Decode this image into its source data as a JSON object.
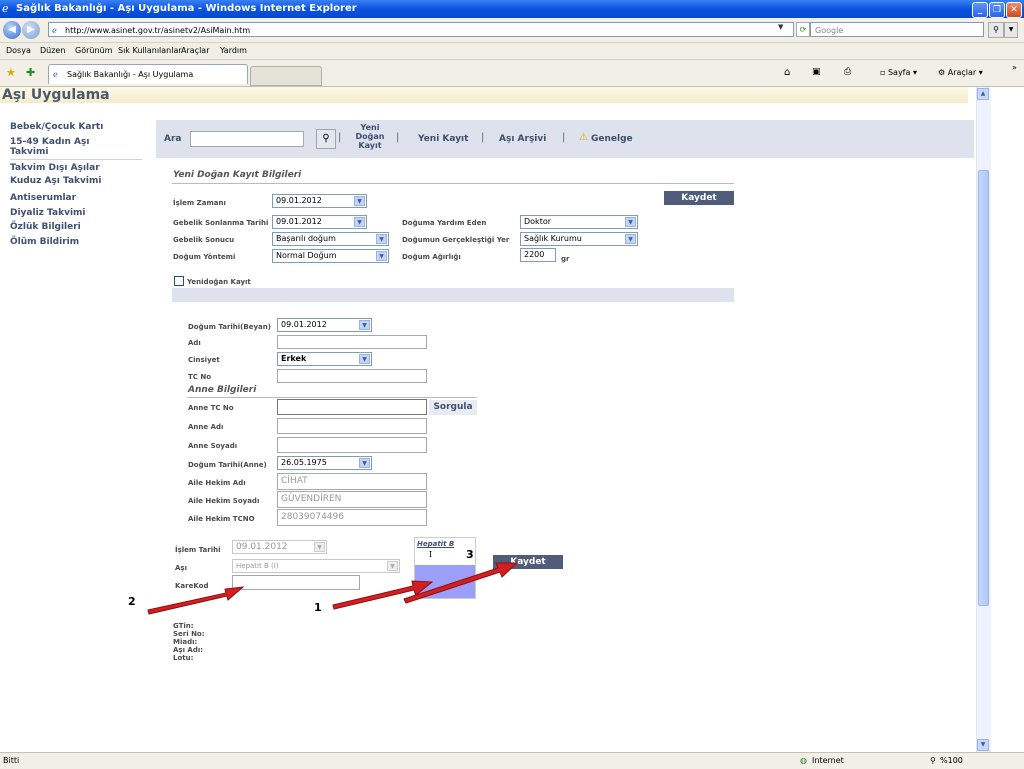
{
  "window": {
    "title": "Sağlık Bakanlığı - Aşı Uygulama - Windows Internet Explorer"
  },
  "address_bar": {
    "url": "http://www.asinet.gov.tr/asinetv2/AsiMain.htm",
    "search_placeholder": "Google"
  },
  "menu": [
    "Dosya",
    "Düzen",
    "Görünüm",
    "Sık Kullanılanlar",
    "Araçlar",
    "Yardım"
  ],
  "tab": {
    "label": "Sağlık Bakanlığı - Aşı Uygulama"
  },
  "toolbar_right": {
    "page_label": "Sayfa",
    "tools_label": "Araçlar"
  },
  "page": {
    "title": "Aşı Uygulama",
    "sidebar": [
      "Bebek/Çocuk Kartı",
      "15-49 Kadın Aşı",
      "Takvimi",
      "Takvim Dışı Aşılar",
      "Kuduz Aşı Takvimi",
      "Antiserumlar",
      "Diyaliz Takvimi",
      "Özlük Bilgileri",
      "Ölüm Bildirim"
    ],
    "searchbar": {
      "search_label": "Ara",
      "new_born_1": "Yeni",
      "new_born_2": "Doğan",
      "new_born_3": "Kayıt",
      "new_record": "Yeni Kayıt",
      "archive": "Aşı Arşivi",
      "circular": "Genelge",
      "sep": "|"
    },
    "birth_section": {
      "title": "Yeni Doğan Kayıt Bilgileri",
      "islem_zamani_label": "İşlem Zamanı",
      "islem_zamani": "09.01.2012",
      "save_button": "Kaydet",
      "gebelik_tarihi_label": "Gebelik Sonlanma Tarihi",
      "gebelik_tarihi": "09.01.2012",
      "yardim_label": "Doğuma Yardım Eden",
      "yardim": "Doktor",
      "gebelik_sonucu_label": "Gebelik Sonucu",
      "gebelik_sonucu": "Başarılı doğum",
      "yer_label": "Doğumun Gerçekleştiği Yer",
      "yer": "Sağlık Kurumu",
      "yontem_label": "Doğum Yöntemi",
      "yontem": "Normal Doğum",
      "agirlik_label": "Doğum Ağırlığı",
      "agirlik": "2200",
      "agirlik_unit": "gr",
      "newborn_checkbox": "Yenidoğan Kayıt"
    },
    "baby": {
      "dogum_tarihi_label": "Doğum Tarihi(Beyan)",
      "dogum_tarihi": "09.01.2012",
      "adi_label": "Adı",
      "cinsiyet_label": "Cinsiyet",
      "cinsiyet": "Erkek",
      "tc_label": "TC No"
    },
    "mother": {
      "title": "Anne Bilgileri",
      "tc_label": "Anne TC No",
      "query_button": "Sorgula",
      "adi_label": "Anne Adı",
      "soyadi_label": "Anne Soyadı",
      "dogum_label": "Doğum Tarihi(Anne)",
      "dogum": "26.05.1975",
      "hekim_adi_label": "Aile Hekim Adı",
      "hekim_adi": "CİHAT",
      "hekim_soyadi_label": "Aile Hekim Soyadı",
      "hekim_soyadi": "GÜVENDİREN",
      "hekim_tc_label": "Aile Hekim TCNO",
      "hekim_tc": "28039074496"
    },
    "vaccine": {
      "islem_tarihi_label": "İşlem Tarihi",
      "islem_tarihi": "09.01.2012",
      "asi_label": "Aşı",
      "asi": "Hepatit B (I)",
      "karekod_label": "KareKod",
      "card_title": "Hepatit B",
      "card_dose": "I",
      "save_button": "Kaydet",
      "info": [
        "GTin:",
        "Seri No:",
        "Miadı:",
        "Aşı Adı:",
        "Lotu:"
      ]
    },
    "annotations": [
      "1",
      "2",
      "3"
    ]
  },
  "status_bar": {
    "left": "Bitti",
    "zone": "Internet",
    "zoom": "%100"
  }
}
